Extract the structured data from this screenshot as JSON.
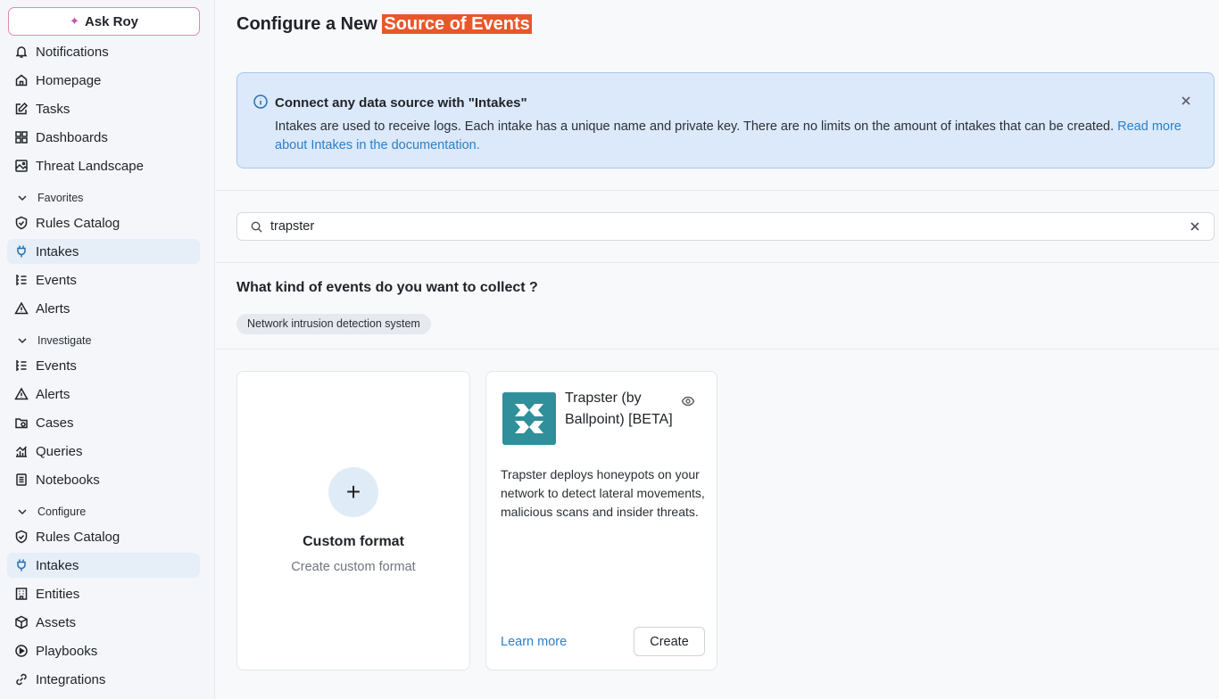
{
  "sidebar": {
    "ask_roy": "Ask Roy",
    "top_items": [
      {
        "label": "Notifications",
        "icon": "bell-icon"
      },
      {
        "label": "Homepage",
        "icon": "home-icon"
      },
      {
        "label": "Tasks",
        "icon": "edit-icon"
      },
      {
        "label": "Dashboards",
        "icon": "dashboard-icon"
      },
      {
        "label": "Threat Landscape",
        "icon": "image-icon"
      }
    ],
    "favorites": {
      "label": "Favorites",
      "items": [
        {
          "label": "Rules Catalog",
          "icon": "shield-icon"
        },
        {
          "label": "Intakes",
          "icon": "plug-icon",
          "active": true
        },
        {
          "label": "Events",
          "icon": "list-icon"
        },
        {
          "label": "Alerts",
          "icon": "alert-icon"
        }
      ]
    },
    "investigate": {
      "label": "Investigate",
      "items": [
        {
          "label": "Events",
          "icon": "list-icon"
        },
        {
          "label": "Alerts",
          "icon": "alert-icon"
        },
        {
          "label": "Cases",
          "icon": "folder-icon"
        },
        {
          "label": "Queries",
          "icon": "chart-icon"
        },
        {
          "label": "Notebooks",
          "icon": "notebook-icon"
        }
      ]
    },
    "configure": {
      "label": "Configure",
      "items": [
        {
          "label": "Rules Catalog",
          "icon": "shield-icon"
        },
        {
          "label": "Intakes",
          "icon": "plug-icon",
          "active": true
        },
        {
          "label": "Entities",
          "icon": "building-icon"
        },
        {
          "label": "Assets",
          "icon": "cube-icon"
        },
        {
          "label": "Playbooks",
          "icon": "play-icon"
        },
        {
          "label": "Integrations",
          "icon": "link-icon"
        }
      ]
    }
  },
  "main": {
    "title_prefix": "Configure a New ",
    "title_highlight": "Source of Events",
    "info": {
      "title": "Connect any data source with \"Intakes\"",
      "body": "Intakes are used to receive logs. Each intake has a unique name and private key. There are no limits on the amount of intakes that can be created. ",
      "link": "Read more about Intakes in the documentation."
    },
    "search": {
      "value": "trapster"
    },
    "question": "What kind of events do you want to collect ?",
    "chip": "Network intrusion detection system",
    "custom_card": {
      "title": "Custom format",
      "subtitle": "Create custom format"
    },
    "intake_card": {
      "title": "Trapster (by Ballpoint) [BETA]",
      "description": "Trapster deploys honeypots on your network to detect lateral movements, malicious scans and insider threats.",
      "learn_more": "Learn more",
      "create": "Create"
    }
  },
  "colors": {
    "accent": "#2a7fc8",
    "highlight": "#e8572a",
    "logo": "#2f8f9a"
  }
}
